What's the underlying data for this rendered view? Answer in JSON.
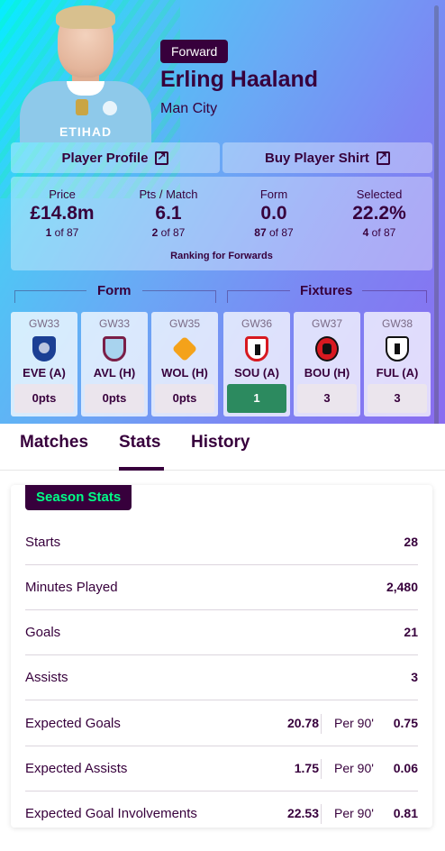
{
  "player": {
    "position": "Forward",
    "name": "Erling Haaland",
    "team": "Man City",
    "sponsor": "ETIHAD"
  },
  "links": {
    "profile": "Player Profile",
    "shirt": "Buy Player Shirt"
  },
  "stats": [
    {
      "label": "Price",
      "value": "£14.8m",
      "rank": "1",
      "of": "of 87"
    },
    {
      "label": "Pts / Match",
      "value": "6.1",
      "rank": "2",
      "of": "of 87"
    },
    {
      "label": "Form",
      "value": "0.0",
      "rank": "87",
      "of": "of 87"
    },
    {
      "label": "Selected",
      "value": "22.2%",
      "rank": "4",
      "of": "of 87"
    }
  ],
  "ranking_note": "Ranking for Forwards",
  "sections": {
    "form": "Form",
    "fixtures": "Fixtures"
  },
  "fixtures": [
    {
      "gw": "GW33",
      "opp": "EVE (A)",
      "pts": "0pts",
      "crest": "everton-crest-icon"
    },
    {
      "gw": "GW33",
      "opp": "AVL (H)",
      "pts": "0pts",
      "crest": "aston-villa-crest-icon"
    },
    {
      "gw": "GW35",
      "opp": "WOL (H)",
      "pts": "0pts",
      "crest": "wolves-crest-icon"
    },
    {
      "gw": "GW36",
      "opp": "SOU (A)",
      "pts": "1",
      "crest": "southampton-crest-icon"
    },
    {
      "gw": "GW37",
      "opp": "BOU (H)",
      "pts": "3",
      "crest": "bournemouth-crest-icon"
    },
    {
      "gw": "GW38",
      "opp": "FUL (A)",
      "pts": "3",
      "crest": "fulham-crest-icon"
    }
  ],
  "colors": {
    "brand": "#37003c",
    "accent": "#00ff87",
    "difficulty_easy": "#2c8a5f",
    "difficulty_neutral": "#ebe5ed"
  },
  "tabs": [
    "Matches",
    "Stats",
    "History"
  ],
  "active_tab": "Stats",
  "season_stats": {
    "title": "Season Stats",
    "rows": [
      {
        "label": "Starts",
        "value": "28"
      },
      {
        "label": "Minutes Played",
        "value": "2,480"
      },
      {
        "label": "Goals",
        "value": "21"
      },
      {
        "label": "Assists",
        "value": "3"
      }
    ],
    "expected_rows": [
      {
        "label": "Expected Goals",
        "value": "20.78",
        "per90_label": "Per 90'",
        "per90": "0.75"
      },
      {
        "label": "Expected Assists",
        "value": "1.75",
        "per90_label": "Per 90'",
        "per90": "0.06"
      },
      {
        "label": "Expected Goal Involvements",
        "value": "22.53",
        "per90_label": "Per 90'",
        "per90": "0.81"
      }
    ]
  }
}
